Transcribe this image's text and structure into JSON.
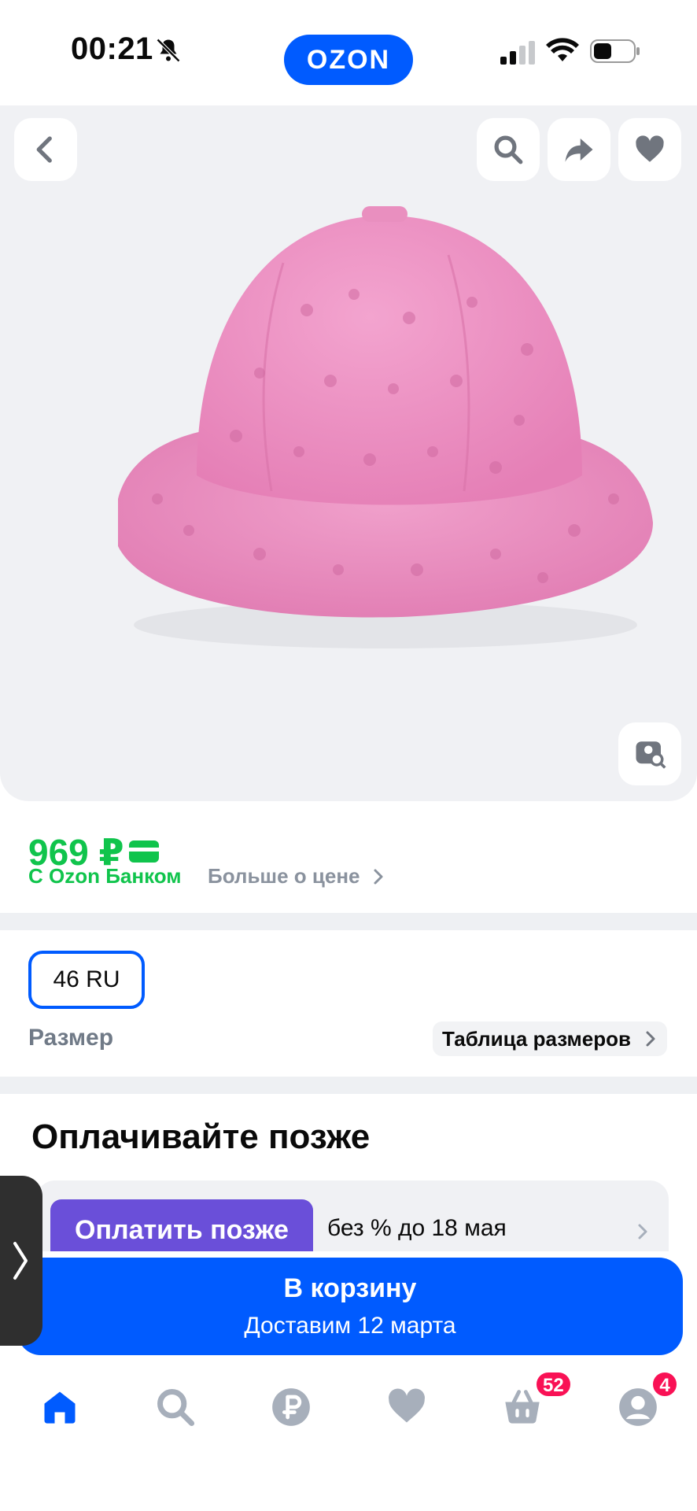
{
  "status_bar": {
    "time": "00:21",
    "logo": "OZON"
  },
  "gallery": {
    "icons": [
      "back-icon",
      "search-icon",
      "share-icon",
      "heart-icon",
      "visual-search-icon"
    ]
  },
  "price": {
    "value": "969 ₽",
    "bank_label": "С Ozon Банком",
    "more_label": "Больше о цене"
  },
  "size": {
    "selected": "46 RU",
    "label": "Размер",
    "table_link": "Таблица размеров"
  },
  "pay_later": {
    "title": "Оплачивайте позже",
    "button": "Оплатить позже",
    "terms": "без % до 18 мая"
  },
  "cart": {
    "label": "В корзину",
    "delivery": "Доставим 12 марта"
  },
  "tabbar": {
    "items": [
      "home-icon",
      "search-icon",
      "ruble-icon",
      "favorites-icon",
      "cart-icon",
      "profile-icon"
    ],
    "cart_badge": "52",
    "profile_badge": "4",
    "accent": "#005bff",
    "inactive": "#a7afbb"
  },
  "colors": {
    "brand": "#005bff",
    "price_green": "#10c44c",
    "badge": "#f91155"
  }
}
